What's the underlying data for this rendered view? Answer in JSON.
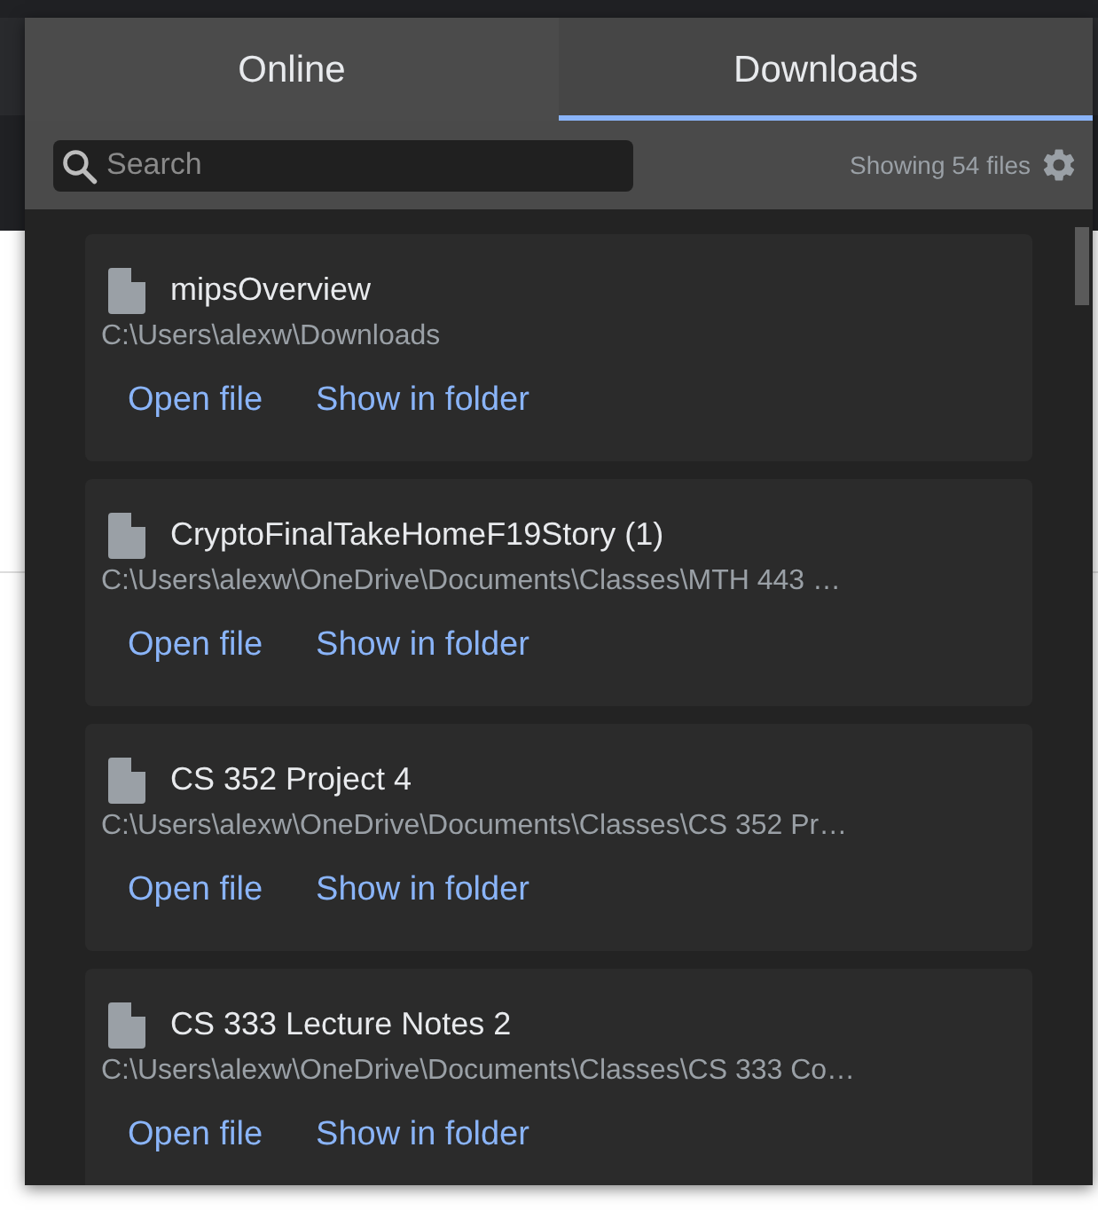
{
  "tabs": [
    {
      "label": "Online",
      "selected": false
    },
    {
      "label": "Downloads",
      "selected": true
    }
  ],
  "search": {
    "placeholder": "Search"
  },
  "file_count": "Showing 54 files",
  "files": [
    {
      "name": "mipsOverview",
      "path": "C:\\Users\\alexw\\Downloads",
      "actions": [
        "Open file",
        "Show in folder"
      ]
    },
    {
      "name": "CryptoFinalTakeHomeF19Story (1)",
      "path": "C:\\Users\\alexw\\OneDrive\\Documents\\Classes\\MTH 443 …",
      "actions": [
        "Open file",
        "Show in folder"
      ]
    },
    {
      "name": "CS 352 Project 4",
      "path": "C:\\Users\\alexw\\OneDrive\\Documents\\Classes\\CS 352 Pr…",
      "actions": [
        "Open file",
        "Show in folder"
      ]
    },
    {
      "name": "CS 333 Lecture Notes 2",
      "path": "C:\\Users\\alexw\\OneDrive\\Documents\\Classes\\CS 333 Co…",
      "actions": [
        "Open file",
        "Show in folder"
      ]
    }
  ]
}
